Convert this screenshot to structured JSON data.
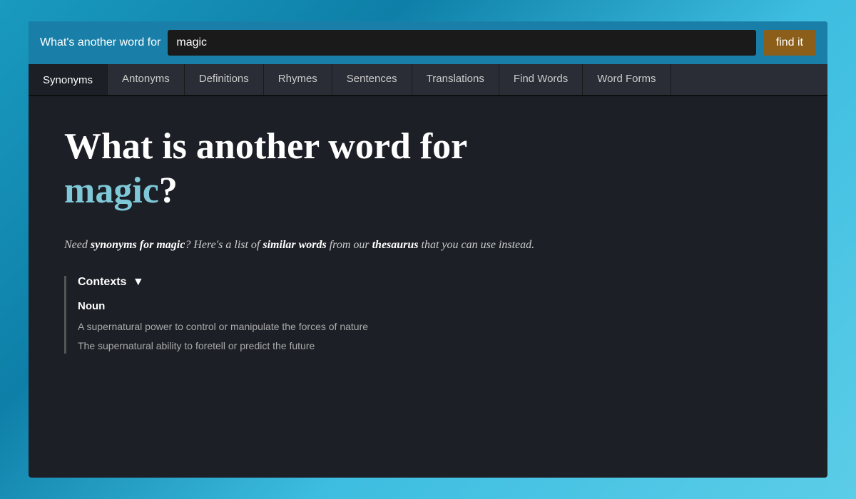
{
  "header": {
    "label": "What's another word for",
    "search_value": "magic",
    "find_button_label": "find it"
  },
  "tabs": [
    {
      "id": "synonyms",
      "label": "Synonyms",
      "active": true
    },
    {
      "id": "antonyms",
      "label": "Antonyms",
      "active": false
    },
    {
      "id": "definitions",
      "label": "Definitions",
      "active": false
    },
    {
      "id": "rhymes",
      "label": "Rhymes",
      "active": false
    },
    {
      "id": "sentences",
      "label": "Sentences",
      "active": false
    },
    {
      "id": "translations",
      "label": "Translations",
      "active": false
    },
    {
      "id": "find-words",
      "label": "Find Words",
      "active": false
    },
    {
      "id": "word-forms",
      "label": "Word Forms",
      "active": false
    }
  ],
  "content": {
    "title_prefix": "What is another word for",
    "title_word": "magic",
    "title_punctuation": "?",
    "description": "Need synonyms for magic? Here's a list of similar words from our thesaurus that you can use instead.",
    "contexts_label": "Contexts",
    "noun_label": "Noun",
    "context_items": [
      "A supernatural power to control or manipulate the forces of nature",
      "The supernatural ability to foretell or predict the future"
    ]
  }
}
